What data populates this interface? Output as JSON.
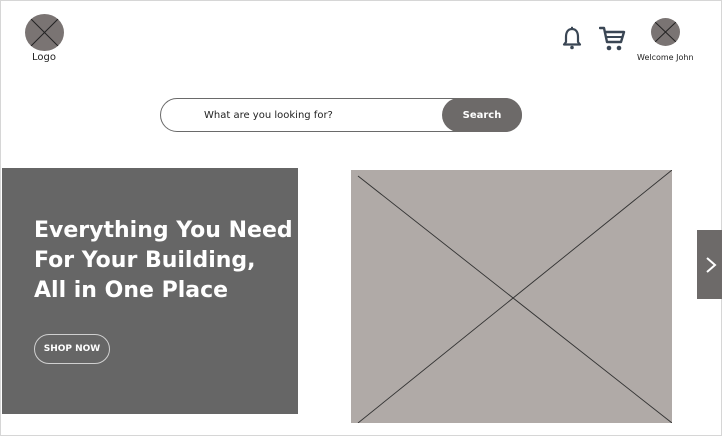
{
  "header": {
    "logo_label": "Logo",
    "welcome_text": "Welcome John"
  },
  "icons": {
    "logo": "logo-placeholder-icon",
    "notifications": "bell-icon",
    "cart": "shopping-cart-icon",
    "avatar": "avatar-placeholder-icon",
    "next": "chevron-right-icon",
    "hero_image": "image-placeholder-icon"
  },
  "search": {
    "placeholder": "What are you looking for?",
    "button_label": "Search"
  },
  "hero": {
    "heading_lines": [
      "Everything You Need",
      "For Your Building,",
      "All in One Place"
    ],
    "cta_label": "SHOP NOW"
  },
  "colors": {
    "hero_panel": "#666666",
    "image_placeholder": "#b0aaa7",
    "button": "#6d6a69"
  }
}
